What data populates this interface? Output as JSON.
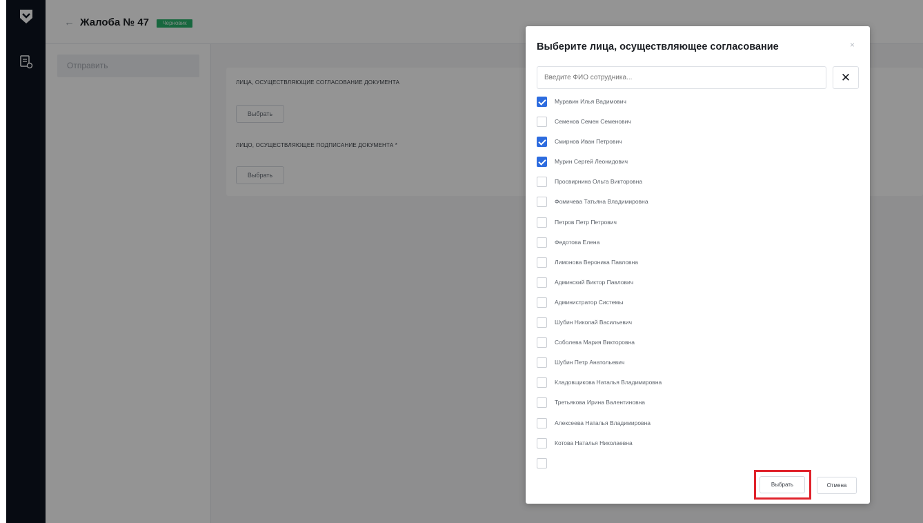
{
  "header": {
    "back_glyph": "←",
    "title": "Жалоба № 47",
    "status_badge": "Черновик"
  },
  "sidebar": {
    "logo_icon": "shield-logo-icon",
    "nav_icon": "document-settings-icon"
  },
  "left_panel": {
    "send_label": "Отправить"
  },
  "card": {
    "approvers_label": "ЛИЦА, ОСУЩЕСТВЛЯЮЩИЕ СОГЛАСОВАНИЕ ДОКУМЕНТА",
    "approvers_button": "Выбрать",
    "signers_label": "ЛИЦО, ОСУЩЕСТВЛЯЮЩЕЕ ПОДПИСАНИЕ ДОКУМЕНТА *",
    "signers_button": "Выбрать"
  },
  "modal": {
    "title": "Выберите лица, осуществляющее согласование",
    "close_glyph": "×",
    "search_placeholder": "Введите ФИО сотрудника...",
    "clear_glyph": "✕",
    "items": [
      {
        "label": "Муравин Илья Вадимович",
        "checked": true
      },
      {
        "label": "Семенов Семен Семенович",
        "checked": false
      },
      {
        "label": "Смирнов Иван Петрович",
        "checked": true
      },
      {
        "label": "Мурин Сергей Леонидович",
        "checked": true
      },
      {
        "label": "Просвирнина Ольга Викторовна",
        "checked": false
      },
      {
        "label": "Фомичева Татьяна Владимировна",
        "checked": false
      },
      {
        "label": "Петров Петр Петрович",
        "checked": false
      },
      {
        "label": "Федотова Елена",
        "checked": false
      },
      {
        "label": "Лимонова Вероника Павловна",
        "checked": false
      },
      {
        "label": "Админский Виктор Павлович",
        "checked": false
      },
      {
        "label": "Администратор Системы",
        "checked": false
      },
      {
        "label": "Шубин Николай Васильевич",
        "checked": false
      },
      {
        "label": "Соболева Мария Викторовна",
        "checked": false
      },
      {
        "label": "Шубин Петр Анатольевич",
        "checked": false
      },
      {
        "label": "Кладовщикова Наталья Владимировна",
        "checked": false
      },
      {
        "label": "Третьякова Ирина Валентиновна",
        "checked": false
      },
      {
        "label": "Алексеева Наталья Владимировна",
        "checked": false
      },
      {
        "label": "Котова Наталья Николаевна",
        "checked": false
      },
      {
        "label": "",
        "checked": false
      }
    ],
    "select_button": "Выбрать",
    "cancel_button": "Отмена"
  }
}
